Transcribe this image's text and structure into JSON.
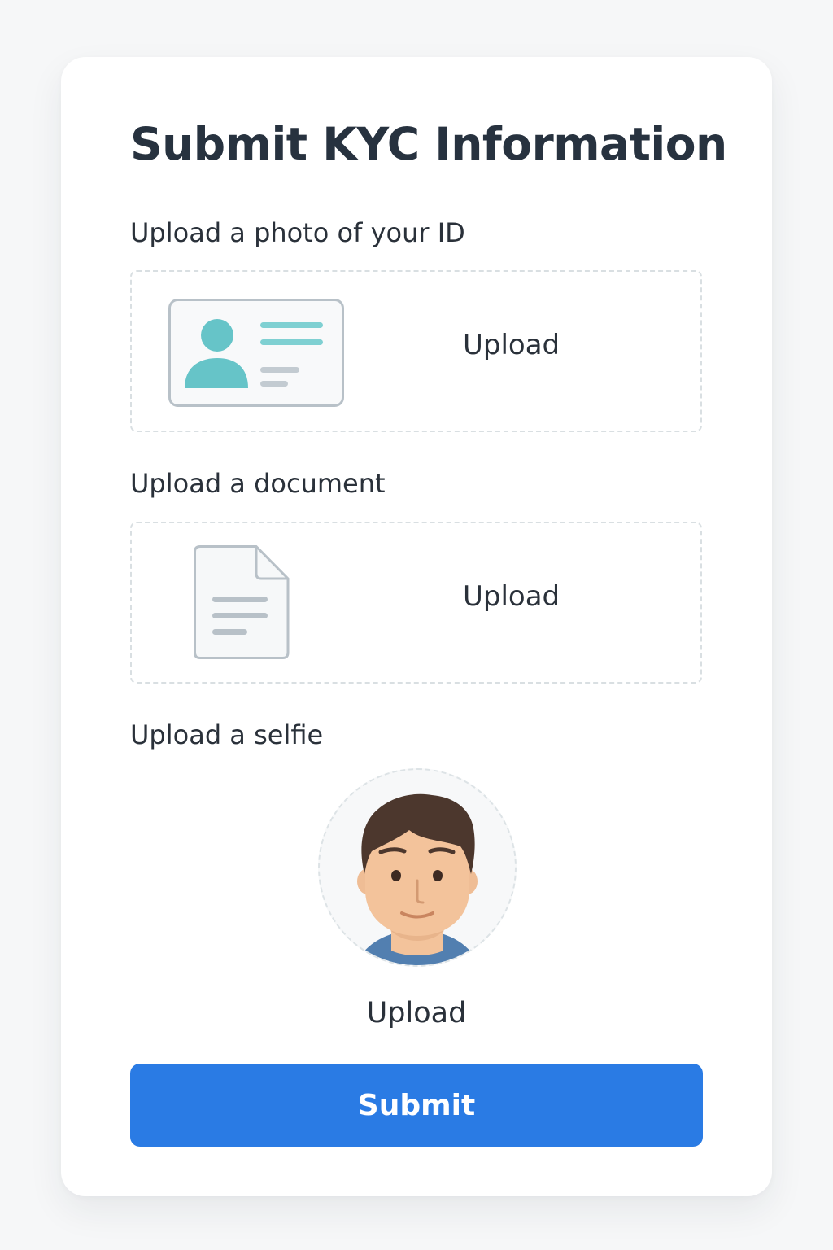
{
  "page": {
    "title": "Submit KYC Information"
  },
  "sections": {
    "id_photo": {
      "label": "Upload a photo of your ID",
      "action": "Upload",
      "icon": "id-card-icon"
    },
    "document": {
      "label": "Upload a document",
      "action": "Upload",
      "icon": "document-icon"
    },
    "selfie": {
      "label": "Upload a selfie",
      "action": "Upload",
      "icon": "selfie-avatar-icon"
    }
  },
  "submit": {
    "label": "Submit"
  },
  "colors": {
    "background": "#f6f7f8",
    "card": "#ffffff",
    "title_text": "#27323f",
    "text": "#2a313a",
    "accent_teal": "#66c4c8",
    "icon_gray": "#b8c1c8",
    "submit_button": "#2a7be4"
  }
}
